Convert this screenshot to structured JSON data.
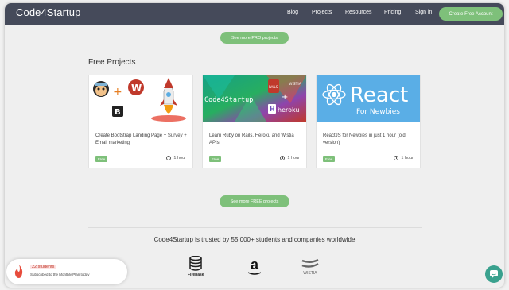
{
  "nav": {
    "brand": "Code4Startup",
    "links": [
      "Blog",
      "Projects",
      "Resources",
      "Pricing",
      "Sign in"
    ],
    "cta": "Create Free Account"
  },
  "see_more_pro": "See more PRO projects",
  "section_title": "Free Projects",
  "cards": [
    {
      "title": "Create Bootstrap Landing Page + Survey + Email marketing",
      "badge": "Free",
      "duration": "1 hour"
    },
    {
      "title": "Learn Ruby on Rails, Heroku and Wistia APIs",
      "badge": "Free",
      "duration": "1 hour",
      "thumb_text": "Code4Startup",
      "thumb_heroku": "heroku",
      "thumb_rails": "RAILS",
      "thumb_wistia": "WISTIA"
    },
    {
      "title": "ReactJS for Newbies in just 1 hour (old version)",
      "badge": "Free",
      "duration": "1 hour",
      "thumb_title": "React",
      "thumb_sub": "For Newbies"
    }
  ],
  "see_more_free": "See more FREE projects",
  "trusted_text": "Code4Startup is trusted by 55,000+ students and companies worldwide",
  "logos": [
    {
      "name": "Firebase",
      "icon": "firebase-icon"
    },
    {
      "name": "a",
      "icon": "amazon-icon"
    },
    {
      "name": "WISTIA",
      "icon": "wistia-icon"
    }
  ],
  "toast": {
    "count": "22 students",
    "text": "Subscribed to the Monthly Plan today"
  },
  "colors": {
    "nav": "#454a5a",
    "accent": "#7ec07a",
    "chat": "#3aa18e"
  }
}
